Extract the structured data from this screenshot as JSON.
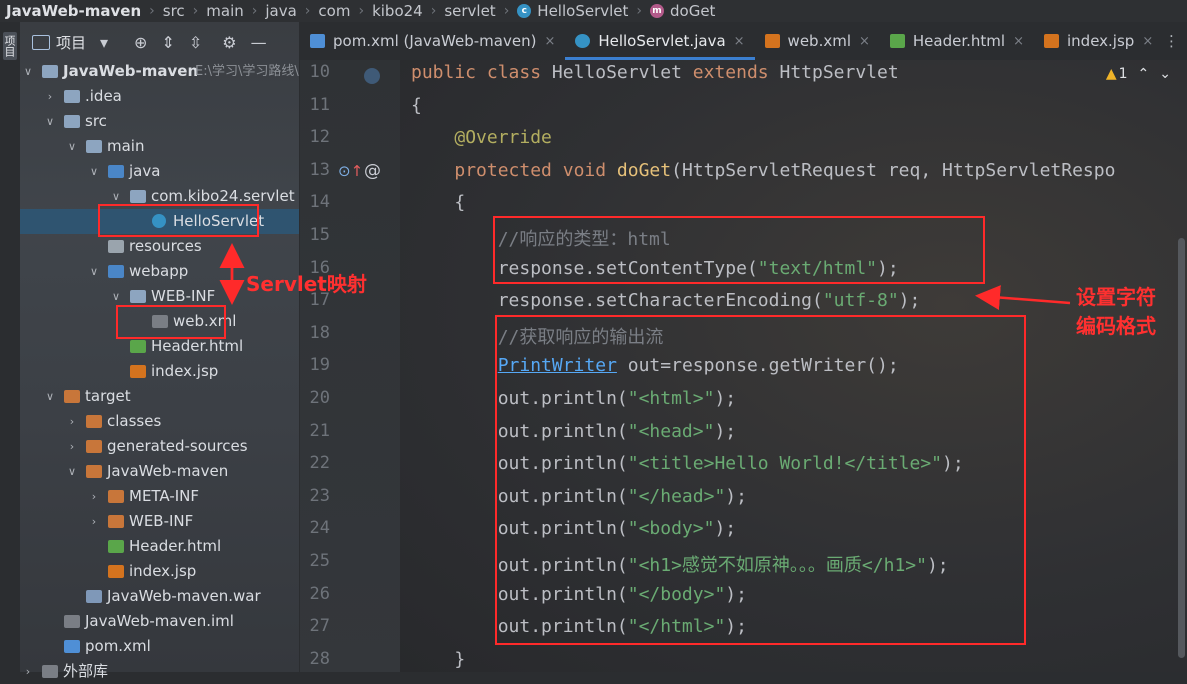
{
  "breadcrumb": [
    {
      "label": "JavaWeb-maven",
      "bold": true
    },
    {
      "label": "src"
    },
    {
      "label": "main"
    },
    {
      "label": "java"
    },
    {
      "label": "com"
    },
    {
      "label": "kibo24"
    },
    {
      "label": "servlet"
    },
    {
      "label": "HelloServlet",
      "icon": "class"
    },
    {
      "label": "doGet",
      "icon": "method"
    }
  ],
  "stripe": {
    "project_label": "项目"
  },
  "panel": {
    "title": "项目",
    "project_path": "E:\\学习\\学习路线\\"
  },
  "tree": [
    {
      "label": "JavaWeb-maven",
      "depth": 0,
      "arrow": "down",
      "icon": "module",
      "bold": true,
      "path": "E:\\学习\\学习路线\\"
    },
    {
      "label": ".idea",
      "depth": 1,
      "arrow": "right",
      "icon": "folder"
    },
    {
      "label": "src",
      "depth": 1,
      "arrow": "down",
      "icon": "folder"
    },
    {
      "label": "main",
      "depth": 2,
      "arrow": "down",
      "icon": "folder"
    },
    {
      "label": "java",
      "depth": 3,
      "arrow": "down",
      "icon": "src-folder"
    },
    {
      "label": "com.kibo24.servlet",
      "depth": 4,
      "arrow": "down",
      "icon": "package"
    },
    {
      "label": "HelloServlet",
      "depth": 5,
      "arrow": "",
      "icon": "class",
      "selected": true
    },
    {
      "label": "resources",
      "depth": 3,
      "arrow": "",
      "icon": "res-folder"
    },
    {
      "label": "webapp",
      "depth": 3,
      "arrow": "down",
      "icon": "web-folder"
    },
    {
      "label": "WEB-INF",
      "depth": 4,
      "arrow": "down",
      "icon": "folder"
    },
    {
      "label": "web.xml",
      "depth": 5,
      "arrow": "",
      "icon": "xml"
    },
    {
      "label": "Header.html",
      "depth": 4,
      "arrow": "",
      "icon": "html"
    },
    {
      "label": "index.jsp",
      "depth": 4,
      "arrow": "",
      "icon": "jsp"
    },
    {
      "label": "target",
      "depth": 1,
      "arrow": "down",
      "icon": "orange-folder"
    },
    {
      "label": "classes",
      "depth": 2,
      "arrow": "right",
      "icon": "orange-folder"
    },
    {
      "label": "generated-sources",
      "depth": 2,
      "arrow": "right",
      "icon": "orange-folder"
    },
    {
      "label": "JavaWeb-maven",
      "depth": 2,
      "arrow": "down",
      "icon": "orange-folder"
    },
    {
      "label": "META-INF",
      "depth": 3,
      "arrow": "right",
      "icon": "orange-folder"
    },
    {
      "label": "WEB-INF",
      "depth": 3,
      "arrow": "right",
      "icon": "orange-folder"
    },
    {
      "label": "Header.html",
      "depth": 3,
      "arrow": "",
      "icon": "html"
    },
    {
      "label": "index.jsp",
      "depth": 3,
      "arrow": "",
      "icon": "jsp"
    },
    {
      "label": "JavaWeb-maven.war",
      "depth": 2,
      "arrow": "",
      "icon": "war"
    },
    {
      "label": "JavaWeb-maven.iml",
      "depth": 1,
      "arrow": "",
      "icon": "iml"
    },
    {
      "label": "pom.xml",
      "depth": 1,
      "arrow": "",
      "icon": "maven"
    },
    {
      "label": "外部库",
      "depth": 0,
      "arrow": "right",
      "icon": "lib"
    }
  ],
  "tabs": [
    {
      "label": "pom.xml (JavaWeb-maven)",
      "icon": "maven"
    },
    {
      "label": "HelloServlet.java",
      "icon": "class",
      "active": true
    },
    {
      "label": "web.xml",
      "icon": "xml"
    },
    {
      "label": "Header.html",
      "icon": "html"
    },
    {
      "label": "index.jsp",
      "icon": "jsp"
    }
  ],
  "inspection": {
    "warning_count": "1"
  },
  "code": [
    {
      "n": "10",
      "tokens": [
        [
          "kw",
          "public "
        ],
        [
          "kw",
          "class "
        ],
        [
          "p",
          "HelloServlet "
        ],
        [
          "kw",
          "extends "
        ],
        [
          "p",
          "HttpServlet"
        ]
      ]
    },
    {
      "n": "11",
      "tokens": [
        [
          "p",
          "{"
        ]
      ]
    },
    {
      "n": "12",
      "tokens": [
        [
          "p",
          "    "
        ],
        [
          "an",
          "@Override"
        ]
      ]
    },
    {
      "n": "13",
      "tokens": [
        [
          "p",
          "    "
        ],
        [
          "kw",
          "protected "
        ],
        [
          "kw",
          "void "
        ],
        [
          "fn",
          "doGet"
        ],
        [
          "p",
          "(HttpServletRequest req, HttpServletRespo"
        ]
      ]
    },
    {
      "n": "14",
      "tokens": [
        [
          "p",
          "    {"
        ]
      ]
    },
    {
      "n": "15",
      "tokens": [
        [
          "p",
          "        "
        ],
        [
          "cm",
          "//响应的类型：html"
        ]
      ]
    },
    {
      "n": "16",
      "tokens": [
        [
          "p",
          "        response.setContentType("
        ],
        [
          "str",
          "\"text/html\""
        ],
        [
          "p",
          ");"
        ]
      ]
    },
    {
      "n": "17",
      "tokens": [
        [
          "p",
          "        response.setCharacterEncoding("
        ],
        [
          "str",
          "\"utf-8\""
        ],
        [
          "p",
          ");"
        ]
      ]
    },
    {
      "n": "18",
      "tokens": [
        [
          "p",
          "        "
        ],
        [
          "cm",
          "//获取响应的输出流"
        ]
      ]
    },
    {
      "n": "19",
      "tokens": [
        [
          "p",
          "        "
        ],
        [
          "ty",
          "PrintWriter"
        ],
        [
          "p",
          " out=response.getWriter();"
        ]
      ]
    },
    {
      "n": "20",
      "tokens": [
        [
          "p",
          "        out.println("
        ],
        [
          "str",
          "\"<html>\""
        ],
        [
          "p",
          ");"
        ]
      ]
    },
    {
      "n": "21",
      "tokens": [
        [
          "p",
          "        out.println("
        ],
        [
          "str",
          "\"<head>\""
        ],
        [
          "p",
          ");"
        ]
      ]
    },
    {
      "n": "22",
      "tokens": [
        [
          "p",
          "        out.println("
        ],
        [
          "str",
          "\"<title>Hello World!</title>\""
        ],
        [
          "p",
          ");"
        ]
      ]
    },
    {
      "n": "23",
      "tokens": [
        [
          "p",
          "        out.println("
        ],
        [
          "str",
          "\"</head>\""
        ],
        [
          "p",
          ");"
        ]
      ]
    },
    {
      "n": "24",
      "tokens": [
        [
          "p",
          "        out.println("
        ],
        [
          "str",
          "\"<body>\""
        ],
        [
          "p",
          ");"
        ]
      ]
    },
    {
      "n": "25",
      "tokens": [
        [
          "p",
          "        out.println("
        ],
        [
          "str",
          "\"<h1>感觉不如原神。。。画质</h1>\""
        ],
        [
          "p",
          ");"
        ]
      ]
    },
    {
      "n": "26",
      "tokens": [
        [
          "p",
          "        out.println("
        ],
        [
          "str",
          "\"</body>\""
        ],
        [
          "p",
          ");"
        ]
      ]
    },
    {
      "n": "27",
      "tokens": [
        [
          "p",
          "        out.println("
        ],
        [
          "str",
          "\"</html>\""
        ],
        [
          "p",
          ");"
        ]
      ]
    },
    {
      "n": "28",
      "tokens": [
        [
          "p",
          "    }"
        ]
      ]
    }
  ],
  "annotations": {
    "servlet_mapping": "Servlet映射",
    "encoding_line1": "设置字符",
    "encoding_line2": "编码格式"
  },
  "colors": {
    "annotation_red": "#ff2a2a",
    "selection": "#2f5470",
    "tab_underline": "#3b7fd0"
  }
}
